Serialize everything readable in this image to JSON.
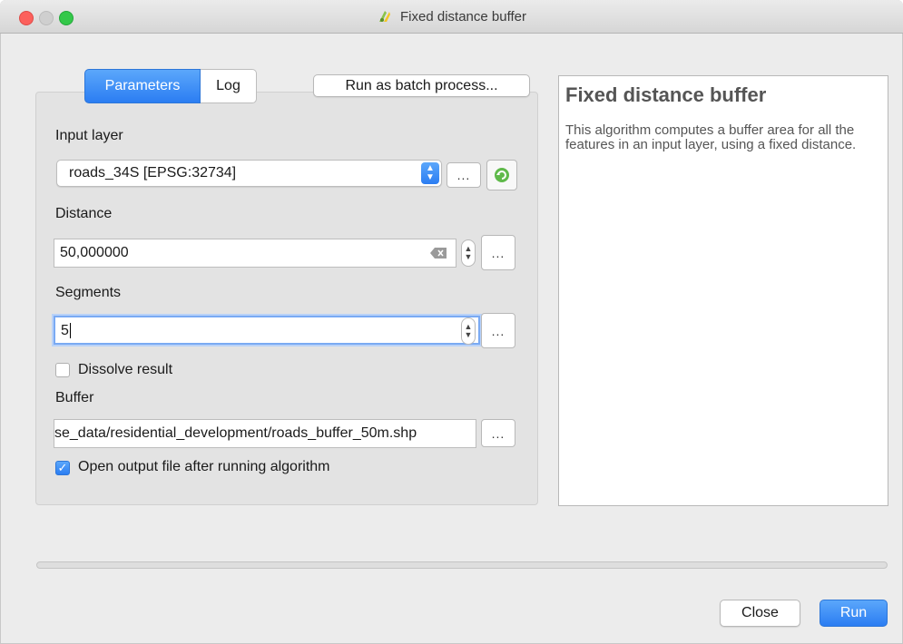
{
  "window": {
    "title": "Fixed distance buffer"
  },
  "tabs": {
    "parameters": "Parameters",
    "log": "Log"
  },
  "batch_button": "Run as batch process...",
  "form": {
    "input_layer": {
      "label": "Input layer",
      "value": "roads_34S [EPSG:32734]",
      "button": "..."
    },
    "distance": {
      "label": "Distance",
      "value": "50,000000",
      "button": "..."
    },
    "segments": {
      "label": "Segments",
      "value": "5",
      "button": "..."
    },
    "dissolve": {
      "label": "Dissolve result",
      "checked": false
    },
    "buffer": {
      "label": "Buffer",
      "value": "se_data/residential_development/roads_buffer_50m.shp",
      "button": "..."
    },
    "open_output": {
      "label": "Open output file after running algorithm",
      "checked": true
    }
  },
  "help": {
    "title": "Fixed distance buffer",
    "body": "This algorithm computes a buffer area for all the features in an input layer, using a fixed distance."
  },
  "progress": 0,
  "buttons": {
    "close": "Close",
    "run": "Run"
  },
  "colors": {
    "accent": "#2b7df2",
    "focus_ring": "#7aaaf3"
  }
}
